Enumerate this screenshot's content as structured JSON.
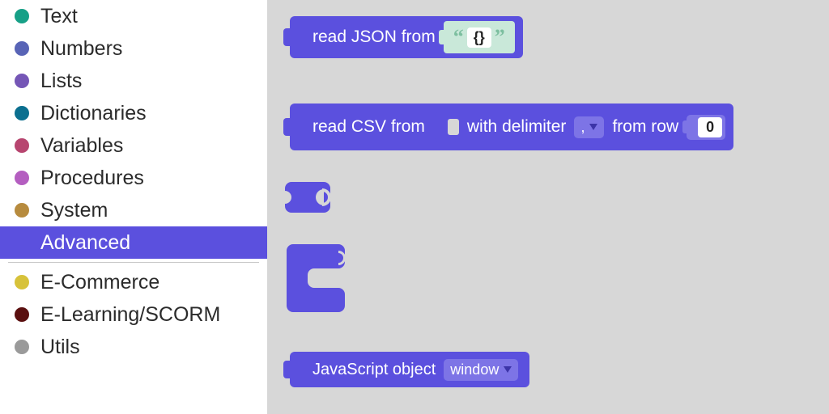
{
  "sidebar": {
    "categories": [
      {
        "label": "Text",
        "color": "#17a087",
        "selected": false
      },
      {
        "label": "Numbers",
        "color": "#5864b6",
        "selected": false
      },
      {
        "label": "Lists",
        "color": "#7556b6",
        "selected": false
      },
      {
        "label": "Dictionaries",
        "color": "#0b6f8f",
        "selected": false
      },
      {
        "label": "Variables",
        "color": "#b7456f",
        "selected": false
      },
      {
        "label": "Procedures",
        "color": "#b45ec0",
        "selected": false
      },
      {
        "label": "System",
        "color": "#b78b3e",
        "selected": false
      },
      {
        "label": "Advanced",
        "color": "#5b50de",
        "selected": true
      }
    ],
    "extra": [
      {
        "label": "E-Commerce",
        "color": "#d7c23a"
      },
      {
        "label": "E-Learning/SCORM",
        "color": "#5a0f0f"
      },
      {
        "label": "Utils",
        "color": "#9a9a9a"
      }
    ]
  },
  "blocks": {
    "readjson": {
      "label": "read JSON from",
      "value": "{}"
    },
    "readcsv": {
      "label1": "read CSV from",
      "label2": "with delimiter",
      "delimiter": ",",
      "label3": "from row",
      "row": "0"
    },
    "jsobject": {
      "label": "JavaScript object",
      "value": "window"
    }
  }
}
